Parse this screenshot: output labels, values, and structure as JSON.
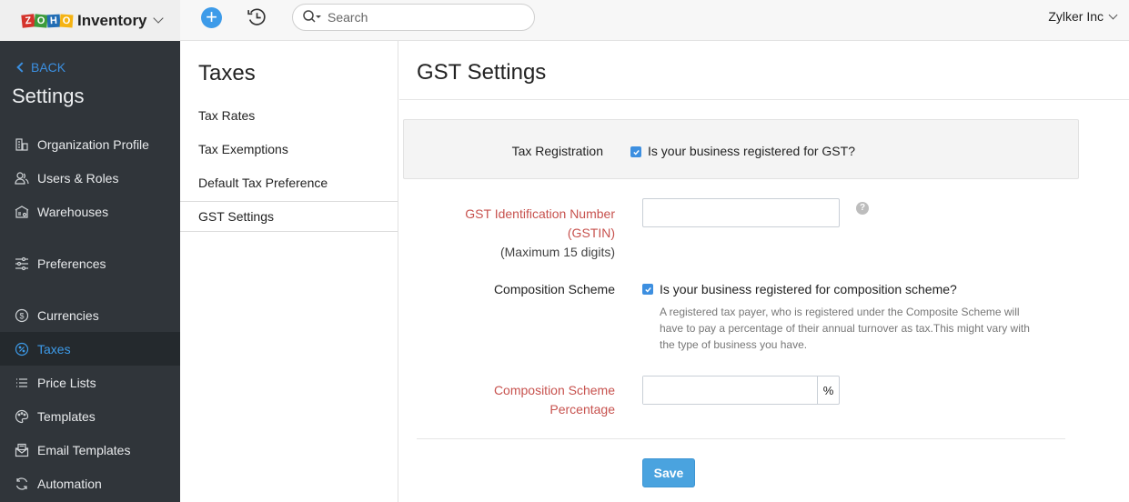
{
  "topbar": {
    "brand_letters": [
      "Z",
      "O",
      "H",
      "O"
    ],
    "app_name": "Inventory",
    "add_icon": "plus-circle-icon",
    "history_icon": "history-clock-icon",
    "search_placeholder": "Search",
    "search_value": "",
    "org_name": "Zylker Inc"
  },
  "sidebar": {
    "back_label": "BACK",
    "title": "Settings",
    "items": [
      {
        "label": "Organization Profile",
        "icon": "building-icon",
        "active": false
      },
      {
        "label": "Users & Roles",
        "icon": "users-icon",
        "active": false
      },
      {
        "label": "Warehouses",
        "icon": "warehouse-icon",
        "active": false
      },
      {
        "label": "Preferences",
        "icon": "sliders-icon",
        "active": false
      },
      {
        "label": "Currencies",
        "icon": "dollar-circle-icon",
        "active": false
      },
      {
        "label": "Taxes",
        "icon": "percent-circle-icon",
        "active": true
      },
      {
        "label": "Price Lists",
        "icon": "list-icon",
        "active": false
      },
      {
        "label": "Templates",
        "icon": "palette-icon",
        "active": false
      },
      {
        "label": "Email Templates",
        "icon": "email-template-icon",
        "active": false
      },
      {
        "label": "Automation",
        "icon": "refresh-icon",
        "active": false
      }
    ]
  },
  "submenu": {
    "title": "Taxes",
    "items": [
      {
        "label": "Tax Rates",
        "active": false
      },
      {
        "label": "Tax Exemptions",
        "active": false
      },
      {
        "label": "Default Tax Preference",
        "active": false
      },
      {
        "label": "GST Settings",
        "active": true
      }
    ]
  },
  "main": {
    "title": "GST Settings",
    "tax_registration": {
      "label": "Tax Registration",
      "checkbox_label": "Is your business registered for GST?",
      "checked": true
    },
    "gstin": {
      "label_line1": "GST Identification Number",
      "label_line2": "(GSTIN)",
      "hint": "(Maximum 15 digits)",
      "value": "",
      "help_icon": "question-circle-icon"
    },
    "composition_scheme": {
      "label": "Composition Scheme",
      "checkbox_label": "Is your business registered for composition scheme?",
      "checked": true,
      "help_line1": "A registered tax payer, who is registered under the Composite Scheme will",
      "help_line2": "have to pay a percentage of their annual turnover as tax.This might vary with",
      "help_line3": "the type of business you have."
    },
    "composition_percentage": {
      "label_line1": "Composition Scheme",
      "label_line2": "Percentage",
      "value": "",
      "addon": "%"
    },
    "save_label": "Save"
  },
  "colors": {
    "accent": "#3d9be9",
    "sidebar_bg": "#30353a",
    "sidebar_active_bg": "#24292d",
    "required_label": "#c7524e",
    "save_button": "#4aa3df"
  }
}
